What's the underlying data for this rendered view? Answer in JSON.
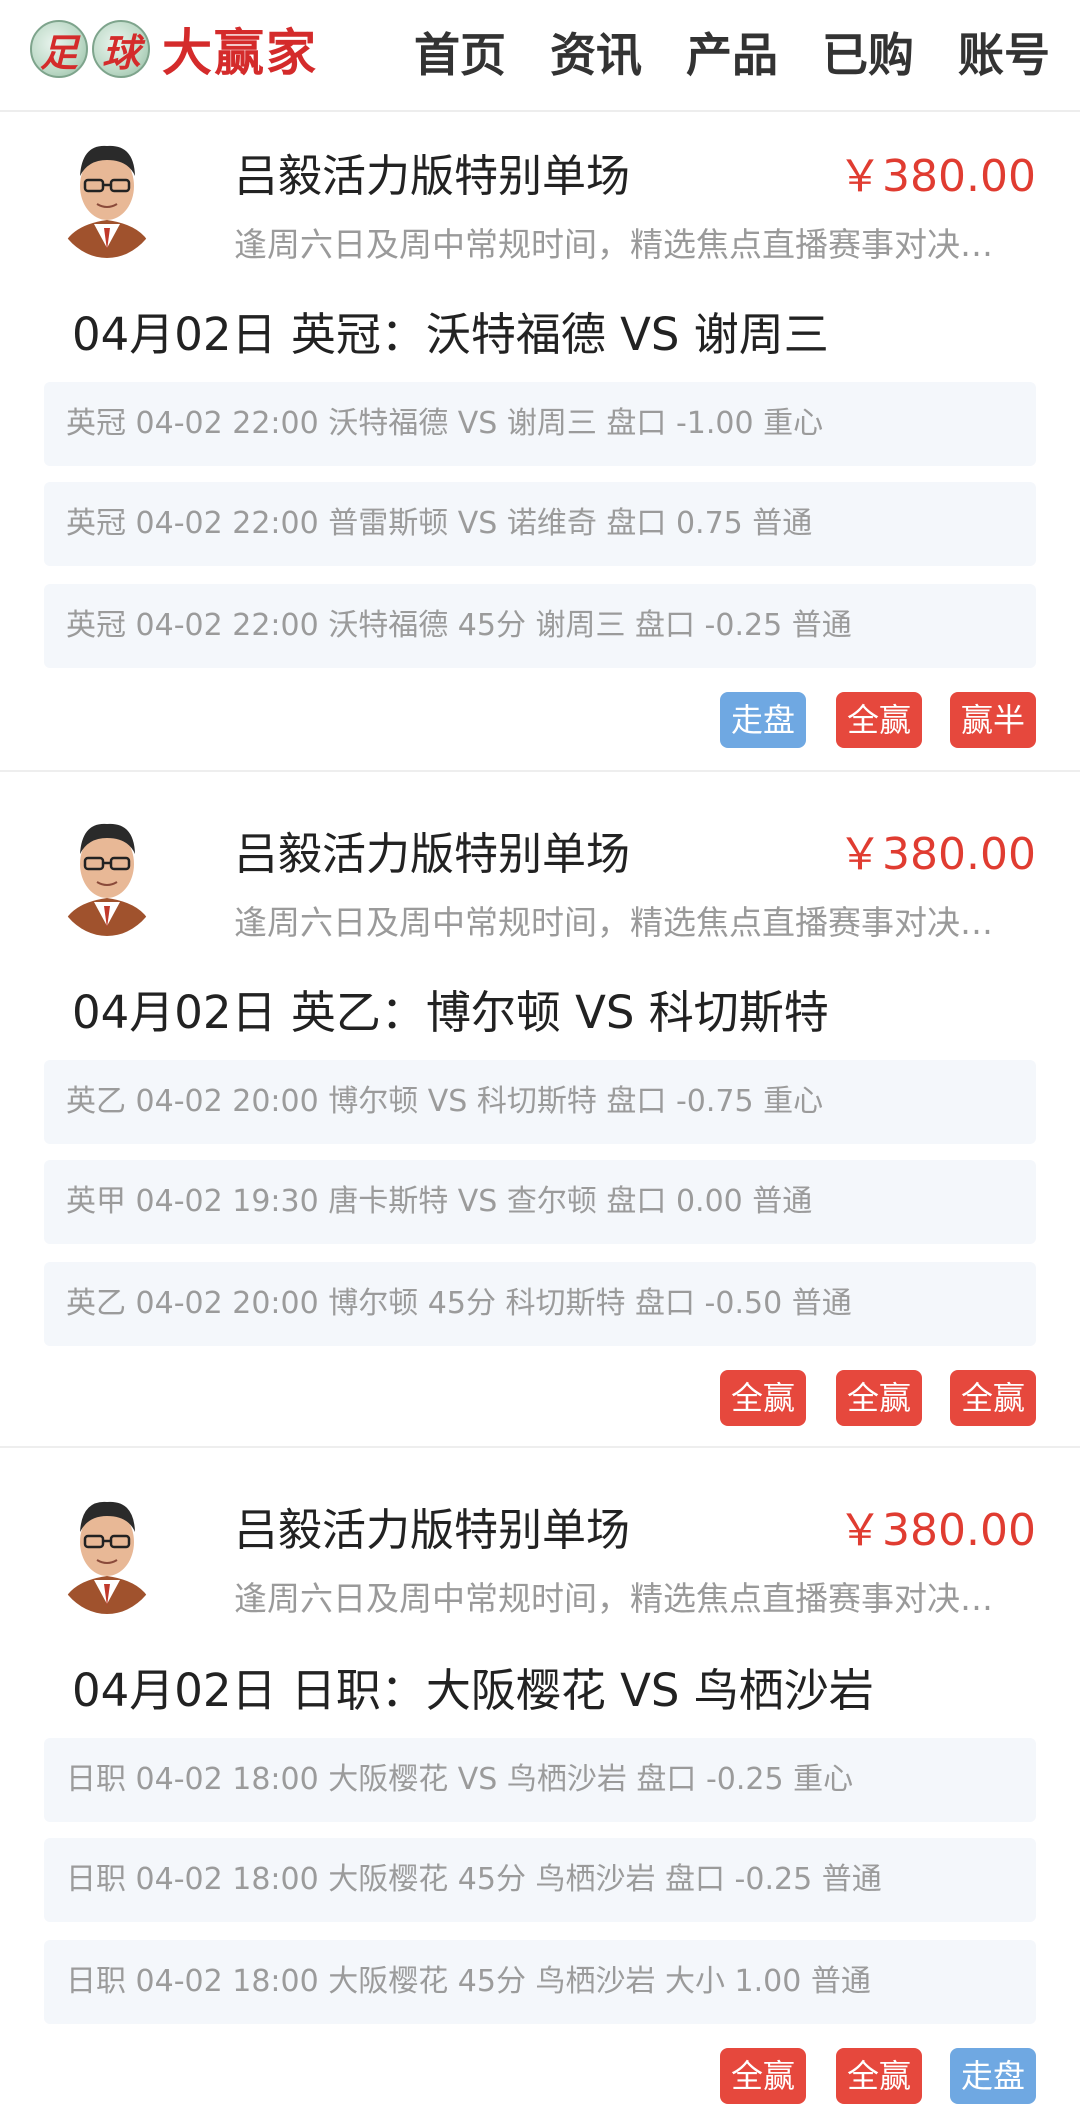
{
  "header": {
    "logo_ball_1": "足",
    "logo_ball_2": "球",
    "logo_text": "大赢家",
    "nav": [
      "首页",
      "资讯",
      "产品",
      "已购",
      "账号"
    ]
  },
  "colors": {
    "price": "#e03c31",
    "badge_red": "#e6483d",
    "badge_blue": "#6fa8e2",
    "row_bg": "#f4f7fb"
  },
  "cards": [
    {
      "product_title": "吕毅活力版特别单场",
      "price": "￥380.00",
      "description": "逢周六日及周中常规时间，精选焦点直播赛事对决…",
      "match_title": "04月02日 英冠：沃特福德 VS 谢周三",
      "picks": [
        "英冠 04-02 22:00   沃特福德 VS 谢周三   盘口 -1.00   重心",
        "英冠 04-02 22:00   普雷斯顿 VS 诺维奇   盘口 0.75   普通",
        "英冠 04-02 22:00   沃特福德 45分 谢周三   盘口 -0.25   普通"
      ],
      "badges": [
        {
          "label": "走盘",
          "color": "blue"
        },
        {
          "label": "全赢",
          "color": "red"
        },
        {
          "label": "赢半",
          "color": "red"
        }
      ]
    },
    {
      "product_title": "吕毅活力版特别单场",
      "price": "￥380.00",
      "description": "逢周六日及周中常规时间，精选焦点直播赛事对决…",
      "match_title": "04月02日 英乙：博尔顿 VS 科切斯特",
      "picks": [
        "英乙 04-02 20:00   博尔顿 VS 科切斯特   盘口 -0.75   重心",
        "英甲 04-02 19:30   唐卡斯特 VS 查尔顿   盘口 0.00   普通",
        "英乙 04-02 20:00   博尔顿 45分 科切斯特   盘口 -0.50   普通"
      ],
      "badges": [
        {
          "label": "全赢",
          "color": "red"
        },
        {
          "label": "全赢",
          "color": "red"
        },
        {
          "label": "全赢",
          "color": "red"
        }
      ]
    },
    {
      "product_title": "吕毅活力版特别单场",
      "price": "￥380.00",
      "description": "逢周六日及周中常规时间，精选焦点直播赛事对决…",
      "match_title": "04月02日 日职：大阪樱花 VS 鸟栖沙岩",
      "picks": [
        "日职 04-02 18:00   大阪樱花 VS 鸟栖沙岩   盘口 -0.25   重心",
        "日职 04-02 18:00   大阪樱花 45分 鸟栖沙岩   盘口 -0.25   普通",
        "日职 04-02 18:00   大阪樱花 45分 鸟栖沙岩   大小 1.00   普通"
      ],
      "badges": [
        {
          "label": "全赢",
          "color": "red"
        },
        {
          "label": "全赢",
          "color": "red"
        },
        {
          "label": "走盘",
          "color": "blue"
        }
      ]
    }
  ]
}
